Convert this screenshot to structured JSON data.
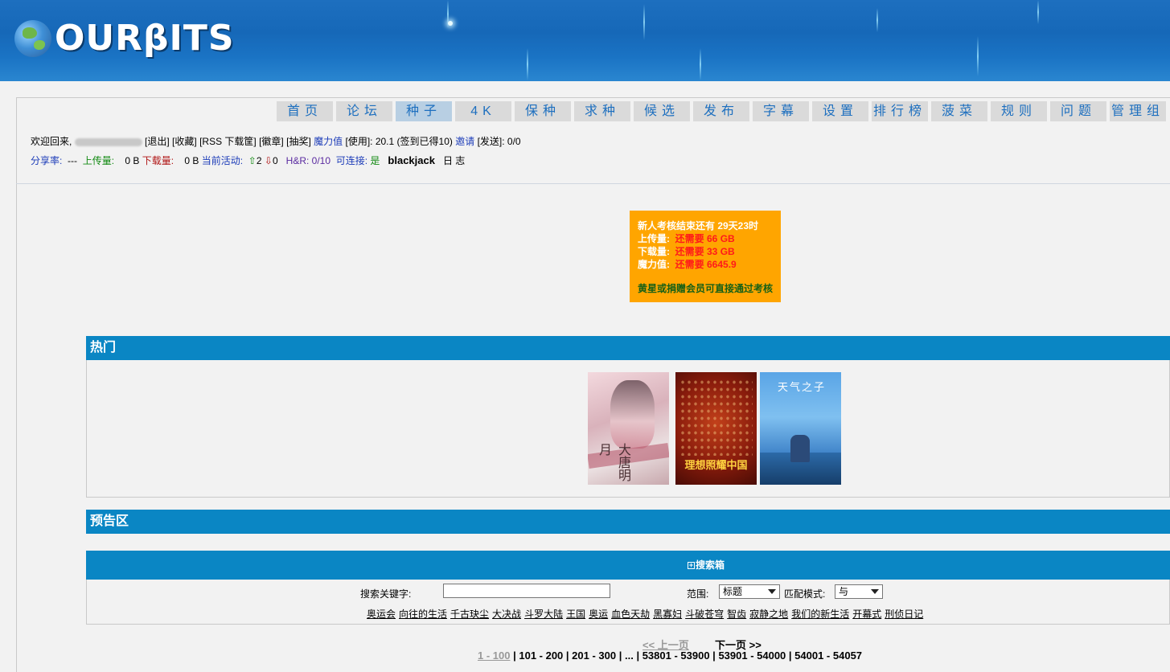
{
  "header": {
    "logo_text": "OURβITS"
  },
  "nav": {
    "items": [
      {
        "label": "首页",
        "active": false
      },
      {
        "label": "论坛",
        "active": false
      },
      {
        "label": "种子",
        "active": true
      },
      {
        "label": "4K",
        "active": false
      },
      {
        "label": "保种",
        "active": false
      },
      {
        "label": "求种",
        "active": false
      },
      {
        "label": "候选",
        "active": false
      },
      {
        "label": "发布",
        "active": false
      },
      {
        "label": "字幕",
        "active": false
      },
      {
        "label": "设置",
        "active": false
      },
      {
        "label": "排行榜",
        "active": false
      },
      {
        "label": "菠菜",
        "active": false
      },
      {
        "label": "规则",
        "active": false
      },
      {
        "label": "问题",
        "active": false
      },
      {
        "label": "管理组",
        "active": false
      }
    ]
  },
  "userinfo": {
    "welcome": "欢迎回来,",
    "logout": "[退出]",
    "bookmarks": "[收藏]",
    "rss": "[RSS 下载筐]",
    "medals": "[徽章]",
    "lottery": "[抽奖]",
    "bonus_label": "魔力值",
    "bonus_use": "[使用]: 20.1",
    "checkin": "(签到已得10)",
    "invite_label": "邀请",
    "invite_send": "[发送]: 0/0",
    "ratio_label": "分享率:",
    "ratio_value": "---",
    "upload_label": "上传量:",
    "upload_value": "0 B",
    "download_label": "下载量:",
    "download_value": "0 B",
    "active_label": "当前活动:",
    "active_seed": "2",
    "active_leech": "0",
    "hr_label": "H&R: 0/10",
    "connectable_label": "可连接:",
    "connectable_value": "是",
    "blackjack": "blackjack",
    "log": "日 志"
  },
  "notice": {
    "title": "新人考核结束还有 29天23时",
    "upload_label": "上传量:",
    "upload_value": "还需要 66 GB",
    "download_label": "下载量:",
    "download_value": "还需要 33 GB",
    "bonus_label": "魔力值:",
    "bonus_value": "还需要 6645.9",
    "footer": "黄星或捐赠会员可直接通过考核"
  },
  "sections": {
    "hot_title": "热门",
    "preview_title": "预告区"
  },
  "posters": [
    {
      "caption": "大唐明月"
    },
    {
      "caption": "理想照耀中国"
    },
    {
      "caption": "天气之子"
    }
  ],
  "search": {
    "title": "搜索箱",
    "keyword_label": "搜索关键字:",
    "keyword_value": "",
    "scope_label": "范围:",
    "scope_value": "标题",
    "match_label": "匹配模式:",
    "match_value": "与",
    "hot_keywords": [
      "奥运会",
      "向往的生活",
      "千古玦尘",
      "大决战",
      "斗罗大陆",
      "王国",
      "奥运",
      "血色天劫",
      "黑寡妇",
      "斗破苍穹",
      "智齿",
      "寂静之地",
      "我们的新生活",
      "开幕式",
      "刑侦日记"
    ]
  },
  "pager": {
    "prev": "<< 上一页",
    "next": "下一页 >>",
    "current": "1 - 100",
    "pages": [
      "101 - 200",
      "201 - 300",
      "...",
      "53801 - 53900",
      "53901 - 54000",
      "54001 - 54057"
    ]
  }
}
